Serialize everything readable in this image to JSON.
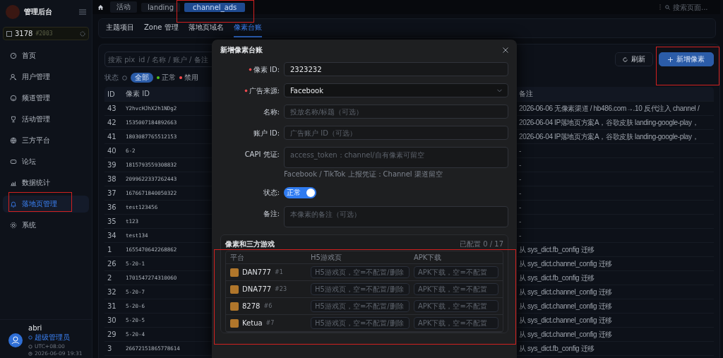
{
  "sidebar": {
    "title": "管理后台",
    "tenant": {
      "code": "3178",
      "id": "#2003"
    },
    "items": [
      {
        "label": "首页",
        "selected": false
      },
      {
        "label": "用户管理",
        "selected": false
      },
      {
        "label": "频道管理",
        "selected": false
      },
      {
        "label": "活动管理",
        "selected": false
      },
      {
        "label": "三方平台",
        "selected": false
      },
      {
        "label": "论坛",
        "selected": false
      },
      {
        "label": "数据统计",
        "selected": false
      },
      {
        "label": "落地页管理",
        "selected": true
      },
      {
        "label": "系统",
        "selected": false
      }
    ],
    "user": {
      "name": "abri",
      "role": "超级管理员",
      "timezone": "UTC+08:00",
      "time": "2026-06-09 19:31"
    }
  },
  "topbar": {
    "tabs": [
      {
        "label": "活动",
        "selected": false
      },
      {
        "label": "landing",
        "selected": false
      },
      {
        "label": "channel_ads",
        "selected": true
      }
    ],
    "search": {
      "placeholder": "搜索页面..."
    }
  },
  "page_tabs": [
    {
      "label": "主题项目",
      "selected": false
    },
    {
      "label": "Zone 管理",
      "selected": false
    },
    {
      "label": "落地页域名",
      "selected": false
    },
    {
      "label": "像素台账",
      "selected": true
    }
  ],
  "toolbar": {
    "search": {
      "placeholder": "搜索 pix_id / 名称 / 账户 / 备注"
    },
    "status_label": "状态",
    "filters": [
      {
        "label": "全部",
        "selected": true
      },
      {
        "label": "正常",
        "selected": false,
        "color": "#52c41a"
      },
      {
        "label": "禁用",
        "selected": false,
        "color": "#ff4d4f"
      }
    ],
    "buttons": [
      {
        "label": "刷新",
        "kind": "default"
      },
      {
        "label": "新增像素",
        "kind": "primary"
      }
    ]
  },
  "table": {
    "columns": [
      "ID",
      "像素 ID",
      "备注"
    ],
    "rows": [
      {
        "id": "43",
        "pixel_id": "Y2hvcHJhX2h1NDg2",
        "note": "2026-06-06 无像素渠道 / hb486.com→.10 反代注入 channel /"
      },
      {
        "id": "42",
        "pixel_id": "1535007184892663",
        "note": "2026-06-04 IP落地页方案A，谷歌皮肤 landing-google-play，"
      },
      {
        "id": "41",
        "pixel_id": "1803087765512153",
        "note": "2026-06-04 IP落地页方案A，谷歌皮肤 landing-google-play，"
      },
      {
        "id": "40",
        "pixel_id": "6-2",
        "note": "-"
      },
      {
        "id": "39",
        "pixel_id": "1815793559308832",
        "note": "-"
      },
      {
        "id": "38",
        "pixel_id": "2099622337262443",
        "note": "-"
      },
      {
        "id": "37",
        "pixel_id": "1676671840050322",
        "note": "-"
      },
      {
        "id": "36",
        "pixel_id": "test123456",
        "note": "-"
      },
      {
        "id": "35",
        "pixel_id": "t123",
        "note": "-"
      },
      {
        "id": "34",
        "pixel_id": "test134",
        "note": "-"
      },
      {
        "id": "1",
        "pixel_id": "1655470642268862",
        "note": "从 sys_dict.fb_config 迁移"
      },
      {
        "id": "26",
        "pixel_id": "5-20-1",
        "note": "从 sys_dict.channel_config 迁移"
      },
      {
        "id": "2",
        "pixel_id": "1701547274310060",
        "note": "从 sys_dict.fb_config 迁移"
      },
      {
        "id": "32",
        "pixel_id": "5-20-7",
        "note": "从 sys_dict.channel_config 迁移"
      },
      {
        "id": "31",
        "pixel_id": "5-20-6",
        "note": "从 sys_dict.channel_config 迁移"
      },
      {
        "id": "30",
        "pixel_id": "5-20-5",
        "note": "从 sys_dict.channel_config 迁移"
      },
      {
        "id": "29",
        "pixel_id": "5-20-4",
        "note": "从 sys_dict.channel_config 迁移"
      },
      {
        "id": "3",
        "pixel_id": "26672151865778614",
        "note": "从 sys_dict.fb_config 迁移"
      }
    ]
  },
  "dialog": {
    "title": "新增像素台账",
    "fields": [
      {
        "label": "像素 ID:",
        "required": true,
        "kind": "input",
        "value": "2323232"
      },
      {
        "label": "广告来源:",
        "required": true,
        "kind": "select",
        "value": "Facebook"
      },
      {
        "label": "名称:",
        "required": false,
        "kind": "input",
        "placeholder": "投放名称/标题（可选）"
      },
      {
        "label": "账户 ID:",
        "required": false,
        "kind": "input",
        "placeholder": "广告账户 ID（可选）"
      },
      {
        "label": "CAPI 凭证:",
        "required": false,
        "kind": "textarea",
        "placeholder": "access_token：channel/自有像素可留空",
        "hint": "Facebook / TikTok 上报凭证：Channel 渠道留空"
      },
      {
        "label": "状态:",
        "required": false,
        "kind": "switch",
        "on": true,
        "text": "正常"
      },
      {
        "label": "备注:",
        "required": false,
        "kind": "textarea",
        "placeholder": "本像素的备注（可选）"
      }
    ],
    "games": {
      "title": "像素和三方游戏",
      "count": "已配置 0 / 17",
      "columns": [
        "平台",
        "H5游戏页",
        "APK下载"
      ],
      "rows": [
        {
          "name": "DAN777",
          "id": "#1",
          "h5_placeholder": "H5游戏页，空=不配置/删除",
          "apk_placeholder": "APK下载，空=不配置"
        },
        {
          "name": "DNA777",
          "id": "#23",
          "h5_placeholder": "H5游戏页，空=不配置/删除",
          "apk_placeholder": "APK下载，空=不配置"
        },
        {
          "name": "8278",
          "id": "#6",
          "h5_placeholder": "H5游戏页，空=不配置/删除",
          "apk_placeholder": "APK下载，空=不配置"
        },
        {
          "name": "Ketua",
          "id": "#7",
          "h5_placeholder": "H5游戏页，空=不配置/删除",
          "apk_placeholder": "APK下载，空=不配置"
        }
      ]
    }
  }
}
